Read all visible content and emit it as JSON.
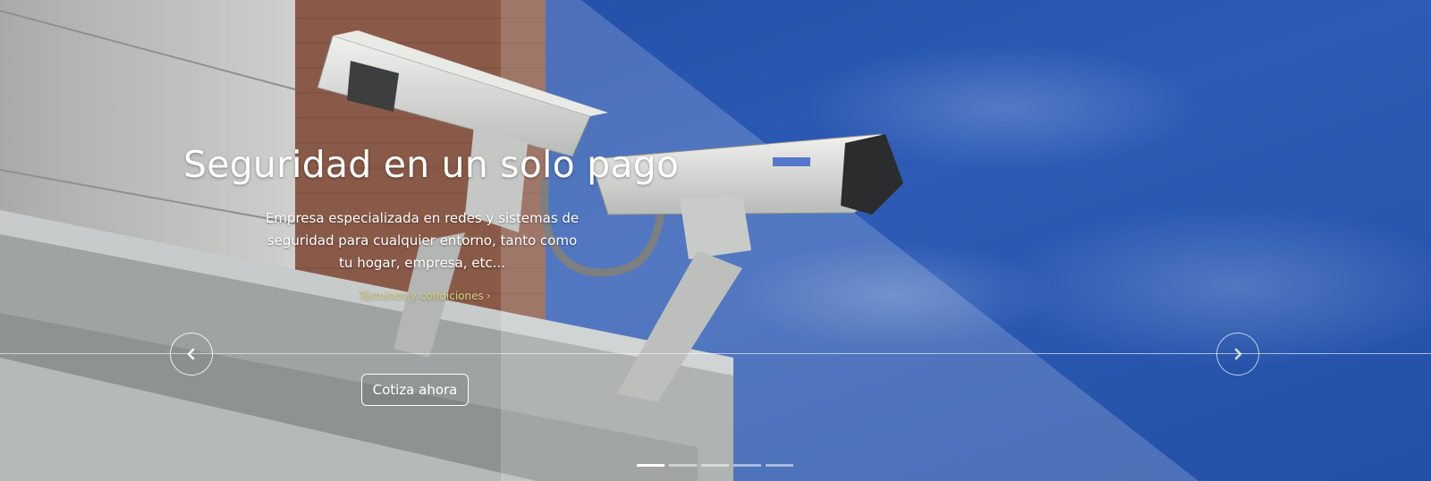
{
  "slide": {
    "title": "Seguridad en un solo pago",
    "description": "Empresa especializada en redes y sistemas de seguridad para cualquier entorno, tanto como tu hogar, empresa, etc...",
    "terms_link": "Términos y condiciones",
    "terms_chevron": "›",
    "cta_label": "Cotiza ahora"
  },
  "carousel": {
    "prev_icon": "chevron-left-icon",
    "next_icon": "chevron-right-icon",
    "indicator_count": 5,
    "active_index": 0
  },
  "colors": {
    "sky": "#2a52a8",
    "link": "#d6cf7a",
    "text": "#ffffff"
  }
}
